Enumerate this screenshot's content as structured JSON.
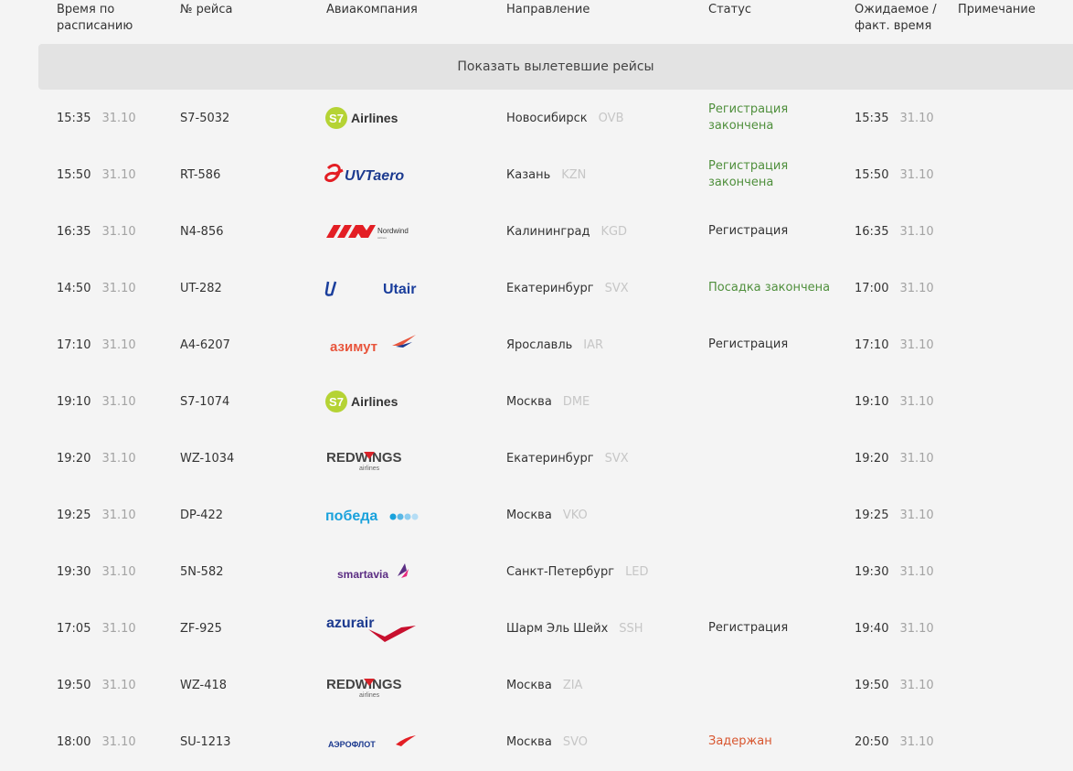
{
  "header": {
    "scheduled": "Время по\nрасписанию",
    "flight_no": "№ рейса",
    "airline": "Авиакомпания",
    "destination": "Направление",
    "status": "Статус",
    "expected": "Ожидаемое /\nфакт. время",
    "note": "Примечание"
  },
  "show_departed_label": "Показать вылетевшие рейсы",
  "flights": [
    {
      "time": "15:35",
      "date": "31.10",
      "flight": "S7-5032",
      "airline_logo": "s7",
      "city": "Новосибирск",
      "code": "OVB",
      "status": "Регистрация\nзакончена",
      "status_type": "green",
      "exp_time": "15:35",
      "exp_date": "31.10"
    },
    {
      "time": "15:50",
      "date": "31.10",
      "flight": "RT-586",
      "airline_logo": "uvt",
      "city": "Казань",
      "code": "KZN",
      "status": "Регистрация\nзакончена",
      "status_type": "green",
      "exp_time": "15:50",
      "exp_date": "31.10"
    },
    {
      "time": "16:35",
      "date": "31.10",
      "flight": "N4-856",
      "airline_logo": "nordwind",
      "city": "Калининград",
      "code": "KGD",
      "status": "Регистрация",
      "status_type": "dark",
      "exp_time": "16:35",
      "exp_date": "31.10"
    },
    {
      "time": "14:50",
      "date": "31.10",
      "flight": "UT-282",
      "airline_logo": "utair",
      "city": "Екатеринбург",
      "code": "SVX",
      "status": "Посадка закончена",
      "status_type": "green",
      "exp_time": "17:00",
      "exp_date": "31.10"
    },
    {
      "time": "17:10",
      "date": "31.10",
      "flight": "A4-6207",
      "airline_logo": "azimut",
      "city": "Ярославль",
      "code": "IAR",
      "status": "Регистрация",
      "status_type": "dark",
      "exp_time": "17:10",
      "exp_date": "31.10"
    },
    {
      "time": "19:10",
      "date": "31.10",
      "flight": "S7-1074",
      "airline_logo": "s7",
      "city": "Москва",
      "code": "DME",
      "status": "",
      "status_type": "dark",
      "exp_time": "19:10",
      "exp_date": "31.10"
    },
    {
      "time": "19:20",
      "date": "31.10",
      "flight": "WZ-1034",
      "airline_logo": "redwings",
      "city": "Екатеринбург",
      "code": "SVX",
      "status": "",
      "status_type": "dark",
      "exp_time": "19:20",
      "exp_date": "31.10"
    },
    {
      "time": "19:25",
      "date": "31.10",
      "flight": "DP-422",
      "airline_logo": "pobeda",
      "city": "Москва",
      "code": "VKO",
      "status": "",
      "status_type": "dark",
      "exp_time": "19:25",
      "exp_date": "31.10"
    },
    {
      "time": "19:30",
      "date": "31.10",
      "flight": "5N-582",
      "airline_logo": "smartavia",
      "city": "Санкт-Петербург",
      "code": "LED",
      "status": "",
      "status_type": "dark",
      "exp_time": "19:30",
      "exp_date": "31.10"
    },
    {
      "time": "17:05",
      "date": "31.10",
      "flight": "ZF-925",
      "airline_logo": "azurair",
      "city": "Шарм Эль Шейх",
      "code": "SSH",
      "status": "Регистрация",
      "status_type": "dark",
      "exp_time": "19:40",
      "exp_date": "31.10"
    },
    {
      "time": "19:50",
      "date": "31.10",
      "flight": "WZ-418",
      "airline_logo": "redwings",
      "city": "Москва",
      "code": "ZIA",
      "status": "",
      "status_type": "dark",
      "exp_time": "19:50",
      "exp_date": "31.10"
    },
    {
      "time": "18:00",
      "date": "31.10",
      "flight": "SU-1213",
      "airline_logo": "aeroflot",
      "city": "Москва",
      "code": "SVO",
      "status": "Задержан",
      "status_type": "red",
      "exp_time": "20:50",
      "exp_date": "31.10"
    }
  ],
  "logos": {
    "s7": {
      "badge": "S7",
      "word": "Airlines"
    },
    "uvt": {
      "word": "UVTaero"
    },
    "nordwind": {
      "word": "Nordwind",
      "sub": "Airlines"
    },
    "utair": {
      "word": "Utair"
    },
    "azimut": {
      "word": "азимут"
    },
    "redwings": {
      "word": "REDWINGS",
      "sub": "airlines"
    },
    "pobeda": {
      "word": "победа"
    },
    "smartavia": {
      "word": "smartavia"
    },
    "azurair": {
      "word": "azurair"
    },
    "aeroflot": {
      "word": "АЭРОФЛОТ"
    }
  },
  "colors": {
    "background": "#f4f4f4",
    "button_bg": "#e3e3e3",
    "status_green": "#4f8f3c",
    "status_red": "#d8562f",
    "muted": "#a3a3a3"
  }
}
